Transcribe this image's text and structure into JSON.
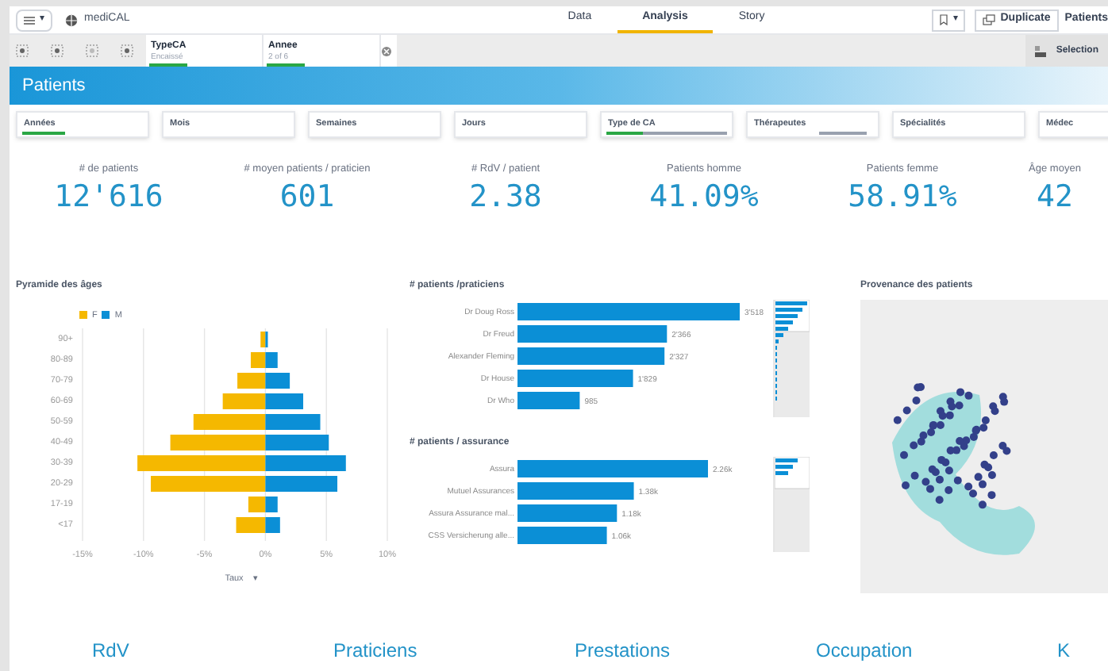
{
  "app": {
    "name": "mediCAL",
    "menu_caret": "▾",
    "bookmark_caret": "▾"
  },
  "nav_tabs": [
    {
      "label": "Data",
      "selected": false
    },
    {
      "label": "Analysis",
      "selected": true
    },
    {
      "label": "Story",
      "selected": false
    }
  ],
  "actions": [
    "Duplicate",
    "Patients"
  ],
  "selections": [
    {
      "field": "TypeCA",
      "value": "Encaissé"
    },
    {
      "field": "Annee",
      "value": "2 of 6"
    }
  ],
  "selections_button": "Selection",
  "sheet_title": "Patients",
  "filters": [
    {
      "label": "Années",
      "selected": true,
      "level": 0.35,
      "excluded": false
    },
    {
      "label": "Mois",
      "selected": false,
      "excluded": false
    },
    {
      "label": "Semaines",
      "selected": false,
      "excluded": false
    },
    {
      "label": "Jours",
      "selected": false,
      "excluded": false
    },
    {
      "label": "Type de CA",
      "selected": true,
      "level": 0.3,
      "excluded": true
    },
    {
      "label": "Thérapeutes",
      "selected": false,
      "excluded": true
    },
    {
      "label": "Spécialités",
      "selected": false,
      "excluded": false
    },
    {
      "label": "Médec",
      "selected": false,
      "excluded": false
    }
  ],
  "kpis": [
    {
      "label": "# de patients",
      "value": "12'616"
    },
    {
      "label": "# moyen patients / praticien",
      "value": "601"
    },
    {
      "label": "# RdV / patient",
      "value": "2.38"
    },
    {
      "label": "Patients homme",
      "value": "41.09%"
    },
    {
      "label": "Patients femme",
      "value": "58.91%"
    },
    {
      "label": "Âge moyen",
      "value": "42"
    }
  ],
  "pyramid": {
    "chart_data": {
      "type": "bar",
      "title": "Pyramide des âges",
      "orientation": "horizontal",
      "stacked": true,
      "xlabel": "Taux",
      "categories": [
        "90+",
        "80-89",
        "70-79",
        "60-69",
        "50-59",
        "40-49",
        "30-39",
        "20-29",
        "17-19",
        "<17"
      ],
      "series": [
        {
          "name": "F",
          "color": "#f5b800",
          "values": [
            -0.4,
            -1.2,
            -2.3,
            -3.5,
            -5.9,
            -7.8,
            -10.5,
            -9.4,
            -1.4,
            -2.4
          ]
        },
        {
          "name": "M",
          "color": "#0b8fd6",
          "values": [
            0.2,
            1.0,
            2.0,
            3.1,
            4.5,
            5.2,
            6.6,
            5.9,
            1.0,
            1.2
          ]
        }
      ],
      "grid": true,
      "xlim": [
        -15,
        10
      ],
      "xticks": [
        {
          "value": -15,
          "label": "-15%"
        },
        {
          "value": -10,
          "label": "-10%"
        },
        {
          "value": -5,
          "label": "-5%"
        },
        {
          "value": 0,
          "label": "0%"
        },
        {
          "value": 5,
          "label": "5%"
        },
        {
          "value": 10,
          "label": "10%"
        }
      ]
    },
    "sort_caret": "▾"
  },
  "praticiens": {
    "chart_data": {
      "type": "bar",
      "title": "# patients /praticiens",
      "orientation": "horizontal",
      "categories": [
        "Dr Doug Ross",
        "Dr Freud",
        "Alexander Fleming",
        "Dr House",
        "Dr Who"
      ],
      "values": [
        3518,
        2366,
        2327,
        1829,
        985
      ],
      "value_labels": [
        "3'518",
        "2'366",
        "2'327",
        "1'829",
        "985"
      ]
    }
  },
  "assurance": {
    "chart_data": {
      "type": "bar",
      "title": "# patients / assurance",
      "orientation": "horizontal",
      "categories": [
        "Assura",
        "Mutuel Assurances",
        "Assura Assurance mal...",
        "CSS Versicherung alle..."
      ],
      "values": [
        2260,
        1380,
        1180,
        1060
      ],
      "value_labels": [
        "2.26k",
        "1.38k",
        "1.18k",
        "1.06k"
      ]
    }
  },
  "map": {
    "title": "Provenance des patients"
  },
  "sections": [
    "RdV",
    "Praticiens",
    "Prestations",
    "Occupation",
    "K"
  ]
}
